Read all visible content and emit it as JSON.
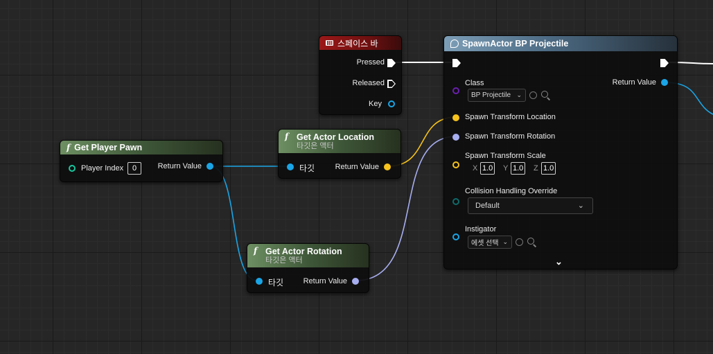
{
  "colors": {
    "exec": "#ffffff",
    "object": "#1aa5e6",
    "vector": "#f6c21c",
    "rotator": "#a7aef0",
    "transform": "#f0a823",
    "class": "#6a1fb0",
    "enum": "#0f6b6b"
  },
  "key_event_node": {
    "icon": "keyboard-icon",
    "title": "스페이스 바",
    "pins": {
      "pressed": "Pressed",
      "released": "Released",
      "key": "Key"
    }
  },
  "get_player_pawn_node": {
    "icon": "function-icon",
    "title": "Get Player Pawn",
    "player_index_label": "Player Index",
    "player_index_value": "0",
    "return_label": "Return Value"
  },
  "get_actor_location_node": {
    "icon": "function-icon",
    "title": "Get Actor Location",
    "subtitle": "타깃은 액터",
    "target_label": "타깃",
    "return_label": "Return Value"
  },
  "get_actor_rotation_node": {
    "icon": "function-icon",
    "title": "Get Actor Rotation",
    "subtitle": "타깃은 액터",
    "target_label": "타깃",
    "return_label": "Return Value"
  },
  "spawn_actor_node": {
    "icon": "spawn-actor-icon",
    "title": "SpawnActor BP Projectile",
    "class_label": "Class",
    "class_value": "BP Projectile",
    "return_label": "Return Value",
    "location_label": "Spawn Transform Location",
    "rotation_label": "Spawn Transform Rotation",
    "scale_label": "Spawn Transform Scale",
    "scale": {
      "x_label": "X",
      "x": "1.0",
      "y_label": "Y",
      "y": "1.0",
      "z_label": "Z",
      "z": "1.0"
    },
    "collision_label": "Collision Handling Override",
    "collision_value": "Default",
    "instigator_label": "Instigator",
    "instigator_value": "에셋 선택",
    "expand_icon": "chevron-down-icon"
  }
}
